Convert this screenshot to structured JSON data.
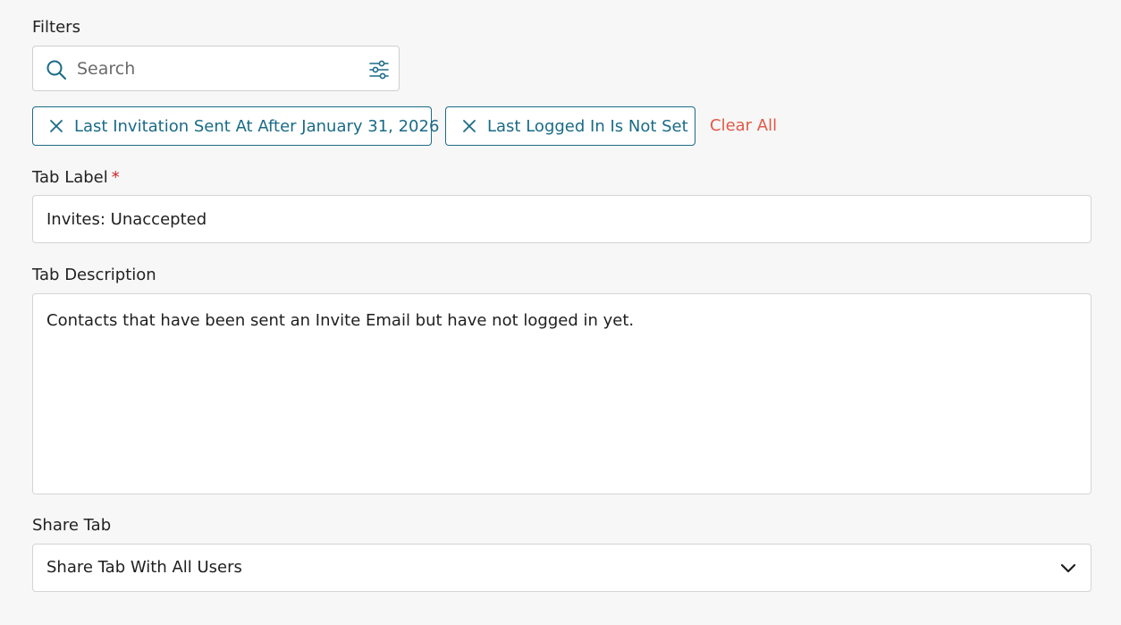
{
  "filters": {
    "label": "Filters",
    "search": {
      "placeholder": "Search",
      "value": ""
    },
    "active": [
      {
        "label": "Last Invitation Sent At After January 31, 2026"
      },
      {
        "label": "Last Logged In Is Not Set"
      }
    ],
    "clear_all_label": "Clear All"
  },
  "tab_label": {
    "label": "Tab Label",
    "required_marker": "*",
    "value": "Invites: Unaccepted"
  },
  "tab_description": {
    "label": "Tab Description",
    "value": "Contacts that have been sent an Invite Email but have not logged in yet."
  },
  "share_tab": {
    "label": "Share Tab",
    "selected": "Share Tab With All Users"
  },
  "colors": {
    "accent": "#1a6b86",
    "danger_link": "#e05a47",
    "required": "#c62828",
    "background": "#f7f7f7"
  },
  "icons": [
    "search-icon",
    "filter-settings-icon",
    "close-icon",
    "chevron-down-icon"
  ]
}
